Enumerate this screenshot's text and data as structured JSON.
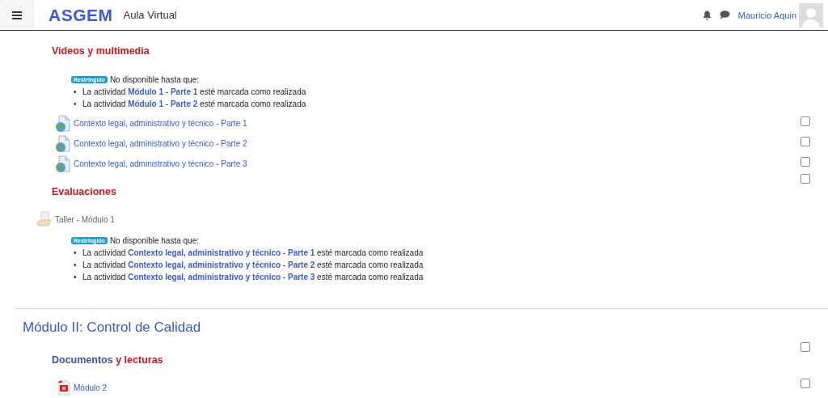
{
  "header": {
    "logo": "ASGEM",
    "site_name": "Aula Virtual",
    "user_name": "Mauricio Aquin"
  },
  "sections": [
    {
      "items": [
        {
          "kind": "heading",
          "parts": [
            {
              "text": "Videos y multimedia",
              "color": "#c8191e"
            }
          ]
        },
        {
          "kind": "restriction",
          "badge": "Restringido",
          "text": "No disponible hasta que:",
          "marker": "•",
          "conditions": [
            "La actividad **Módulo 1** - **Parte 1** esté marcada como realizada",
            "La actividad **Módulo 1** - **Parte 2** esté marcada como realizada"
          ]
        },
        {
          "kind": "page",
          "title": "Contexto legal, administrativo y técnico - Parte 1",
          "checked": false
        },
        {
          "kind": "page",
          "title": "Contexto legal, administrativo y técnico - Parte 2",
          "checked": false
        },
        {
          "kind": "page",
          "title": "Contexto legal, administrativo y técnico - Parte 3",
          "checked": false
        },
        {
          "kind": "heading",
          "parts": [
            {
              "text": "Evaluaciones",
              "color": "#c8191e"
            }
          ],
          "checked": false
        },
        {
          "kind": "assignment",
          "title": "Taller - Módulo 1"
        },
        {
          "kind": "restriction",
          "badge": "Restringido",
          "text": "No disponible hasta que:",
          "marker": "•",
          "conditions": [
            "La actividad **Contexto legal, administrativo y técnico** - **Parte 1** esté marcada como realizada",
            "La actividad **Contexto legal, administrativo y técnico** - **Parte 2** esté marcada como realizada",
            "La actividad **Contexto legal, administrativo y técnico** - **Parte 3** esté marcada como realizada"
          ]
        }
      ]
    },
    {
      "title": "Módulo II: Control de Calidad",
      "items": [
        {
          "kind": "heading",
          "parts": [
            {
              "text": "Documentos",
              "color": "#3f51b5"
            },
            {
              "text": "y lecturas",
              "color": "#c8191e"
            }
          ],
          "checked": false
        },
        {
          "kind": "pdf",
          "title": "Módulo 2",
          "checked": false
        }
      ]
    }
  ]
}
